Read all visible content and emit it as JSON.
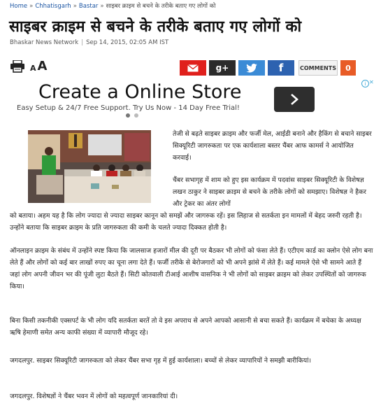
{
  "breadcrumb": {
    "home": "Home",
    "state": "Chhatisgarh",
    "city": "Bastar",
    "current": "साइबर क्राइम से बचने के तरीके बताए गए लोगों को"
  },
  "article": {
    "title": "साइबर क्राइम से बचने के तरीके बताए गए लोगों को",
    "source": "Bhaskar News Network",
    "date": "Sep 14, 2015, 02:05 AM IST"
  },
  "toolbar": {
    "font_small": "A",
    "font_large": "A",
    "gplus_label": "g+",
    "fb_label": "f",
    "comments_label": "COMMENTS",
    "comments_count": "0"
  },
  "ad": {
    "title": "Create a Online Store",
    "subtitle": "Easy Setup & 24/7 Free Support. Try Us Now - 14 Day Free Trial!"
  },
  "body": {
    "p1": "तेजी से बढ़ते साइबर क्राइम और फर्जी मेल, आईडी बनाने और हैकिंग से बचाने साइबर सिक्यूरिटी जागरुकता पर एक कार्यशाला बस्तर चैंबर आफ कामर्स ने आयोजित करवाई।",
    "p2": "चैंबर सभागृह में शाम को हुए इस कार्यक्रम में पदवांस साइबर सिक्यूरिटी के विशेषज्ञ लखन ठाकुर ने साइबर क्राइम से बचने के तरीके लोगों को समझाए। विशेषज्ञ ने हैकर और ट्रेकर का अंतर लोगों",
    "p2b": "को बताया। अहम यह है कि लोग ज्यादा से ज्यादा साइबर कानून को समझें और जागरुक रहें। इस लिहाज से सतर्कता इन मामलों में बेहद जरुरी रहती है। उन्होंने बताया कि साइबर क्राइम के प्रति जागरुकता की कमी के चलते ज्यादा दिक्कत होती है।",
    "p3": "ऑनलाइन क्राइम के संबंध में उन्होंने स्पष्ट किया कि जालसाज हजारों मील की दूरी पर बैठकर भी लोगों को फंसा लेते हैं। एटीएम कार्ड का क्लोन ऐसे लोग बना लेते हैं और लोगों को कई बार लाखों रुपए का चूना लगा देते हैं। फर्जी तरीके से बेरोजगारों को भी अपने झांसे में लेते हैं। कई मामले ऐसे भी सामने आते हैं जहां लोग अपनी जीवन भर की पूंजी लुटा बैठते हैं। सिटी कोतवाली टीआई आशीष वासनिक ने भी लोगों को साइबर क्राइम को लेकर उपस्थितों को जागरुक किया।",
    "p4": "बिना किसी तकनीकी एक्सपर्ट के भी लोग यदि सतर्कता बरतें तो वे इस अपराध से अपने आपको आसानी से बचा सकते हैं। कार्यक्रम में बचेका के अध्यक्ष ऋषि हेमाणी समेत अन्य काफी संख्या में व्यापारी मौजूद रहे।",
    "p5": "जगदलपुर. साइबर सिक्यूरिटी जागरुकता को लेकर चैंबर सभा गृह में हुई कार्यशाला। बच्चों से लेकर व्यापारियों ने समझी बारीकियां।",
    "p6": "जगदलपुर. विशेषज्ञों ने चैंबर भवन में लोगों को महत्वपूर्ण जानकारियां दी।"
  }
}
